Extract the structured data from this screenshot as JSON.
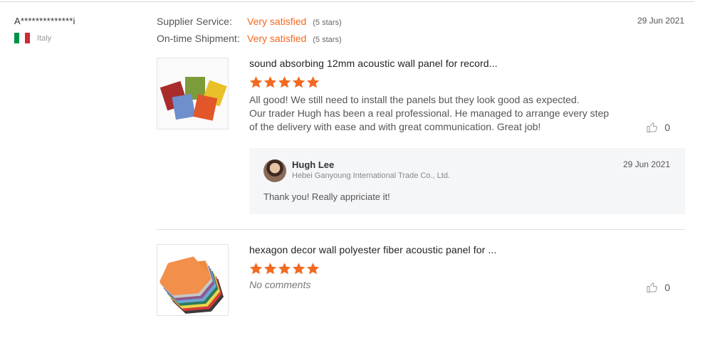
{
  "reviewer": {
    "name": "A**************i",
    "country": "Italy",
    "flag_colors": [
      "#009246",
      "#ffffff",
      "#ce2b37"
    ]
  },
  "ratings": [
    {
      "label": "Supplier Service:",
      "value": "Very satisfied",
      "stars": "(5 stars)"
    },
    {
      "label": "On-time Shipment:",
      "value": "Very satisfied",
      "stars": "(5 stars)"
    }
  ],
  "review_date": "29 Jun 2021",
  "accent_color": "#f26a21",
  "reviews": [
    {
      "product_title": "sound absorbing 12mm acoustic wall panel for record...",
      "star_count": 5,
      "comment_lines": [
        "All good! We still need to install the panels but they look good as expected.",
        "Our trader Hugh has been a real professional. He managed to arrange every step",
        "of the delivery with ease and with great communication. Great job!"
      ],
      "likes": "0",
      "reply": {
        "name": "Hugh Lee",
        "company": "Hebei Ganyoung International Trade Co., Ltd.",
        "date": "29 Jun 2021",
        "text": "Thank you! Really appriciate it!"
      }
    },
    {
      "product_title": "hexagon decor wall polyester fiber acoustic panel for ...",
      "star_count": 5,
      "comment": "No comments",
      "likes": "0"
    }
  ],
  "icons": {
    "star": "star-icon",
    "like": "thumbs-up-icon",
    "flag": "italy-flag-icon",
    "avatar": "avatar"
  }
}
